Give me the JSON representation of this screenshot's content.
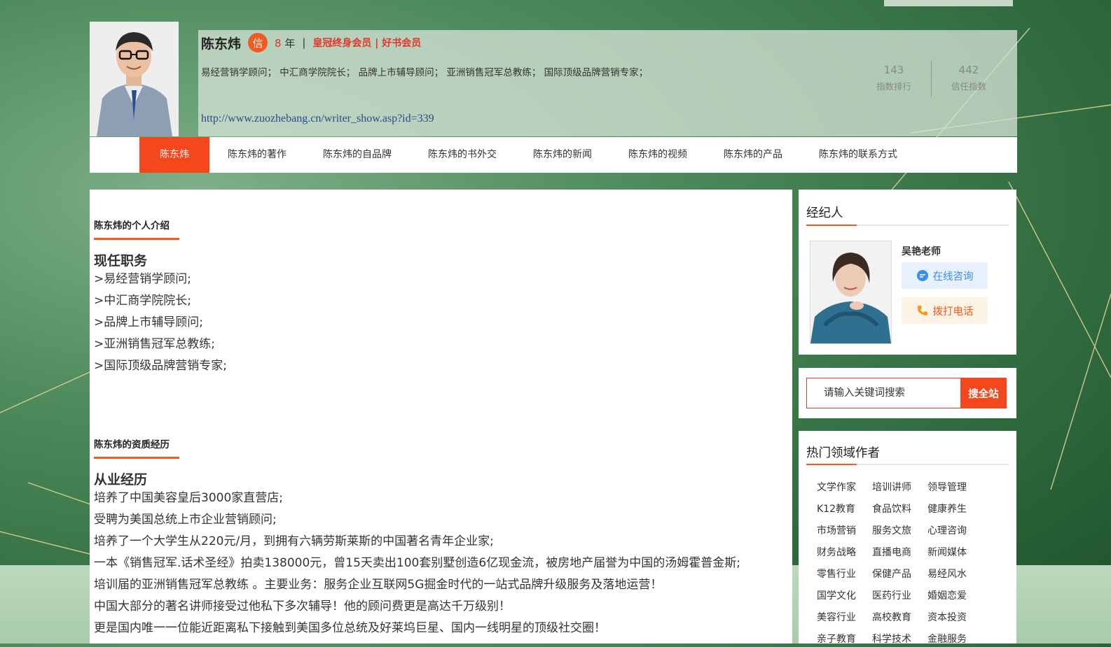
{
  "author": {
    "name": "陈东炜",
    "trust_badge": "信",
    "years": "8",
    "years_unit": "年",
    "separator": "|",
    "membership": "皇冠终身会员 | 好书会员",
    "titles": "易经营销学顾问； 中汇商学院院长； 品牌上市辅导顾问； 亚洲销售冠军总教练； 国际顶级品牌营销专家；",
    "url": "http://www.zuozhebang.cn/writer_show.asp?id=339"
  },
  "stats": [
    {
      "value": "143",
      "label": "指数排行"
    },
    {
      "value": "442",
      "label": "信任指数"
    }
  ],
  "nav": [
    {
      "label": "陈东炜",
      "active": true
    },
    {
      "label": "陈东炜的著作"
    },
    {
      "label": "陈东炜的自品牌"
    },
    {
      "label": "陈东炜的书外交"
    },
    {
      "label": "陈东炜的新闻"
    },
    {
      "label": "陈东炜的视频"
    },
    {
      "label": "陈东炜的产品"
    },
    {
      "label": "陈东炜的联系方式"
    }
  ],
  "intro": {
    "title": "陈东炜的个人介绍",
    "heading": "现任职务",
    "lines": [
      ">易经营销学顾问;",
      ">中汇商学院院长;",
      ">品牌上市辅导顾问;",
      ">亚洲销售冠军总教练;",
      ">国际顶级品牌营销专家;"
    ]
  },
  "experience": {
    "title": "陈东炜的资质经历",
    "heading": "从业经历",
    "lines": [
      "培养了中国美容皇后3000家直营店;",
      "受聘为美国总统上市企业营销顾问;",
      "培养了一个大学生从220元/月，到拥有六辆劳斯莱斯的中国著名青年企业家;",
      "一本《销售冠军.话术圣经》拍卖138000元，曾15天卖出100套别墅创造6亿现金流，被房地产届誉为中国的汤姆霍普金斯;",
      "培训届的亚洲销售冠军总教练 。主要业务：服务企业互联网5G掘金时代的一站式品牌升级服务及落地运营！",
      "中国大部分的著名讲师接受过他私下多次辅导！他的顾问费更是高达千万级别！",
      "更是国内唯一一位能近距离私下接触到美国多位总统及好莱坞巨星、国内一线明星的顶级社交圈！"
    ]
  },
  "agent": {
    "title": "经纪人",
    "name": "吴艳老师",
    "consult_label": "在线咨询",
    "call_label": "拨打电话"
  },
  "search": {
    "placeholder": "请输入关键词搜索",
    "button": "搜全站"
  },
  "hot": {
    "title": "热门领域作者",
    "categories": [
      "文学作家",
      "培训讲师",
      "领导管理",
      "K12教育",
      "食品饮料",
      "健康养生",
      "市场营销",
      "服务文旅",
      "心理咨询",
      "财务战略",
      "直播电商",
      "新闻媒体",
      "零售行业",
      "保健产品",
      "易经风水",
      "国学文化",
      "医药行业",
      "婚姻恋爱",
      "美容行业",
      "高校教育",
      "资本投资",
      "亲子教育",
      "科学技术",
      "金融服务"
    ]
  },
  "colors": {
    "accent": "#f5471c",
    "link": "#2b4a8a",
    "background": "#3f7d4e"
  }
}
